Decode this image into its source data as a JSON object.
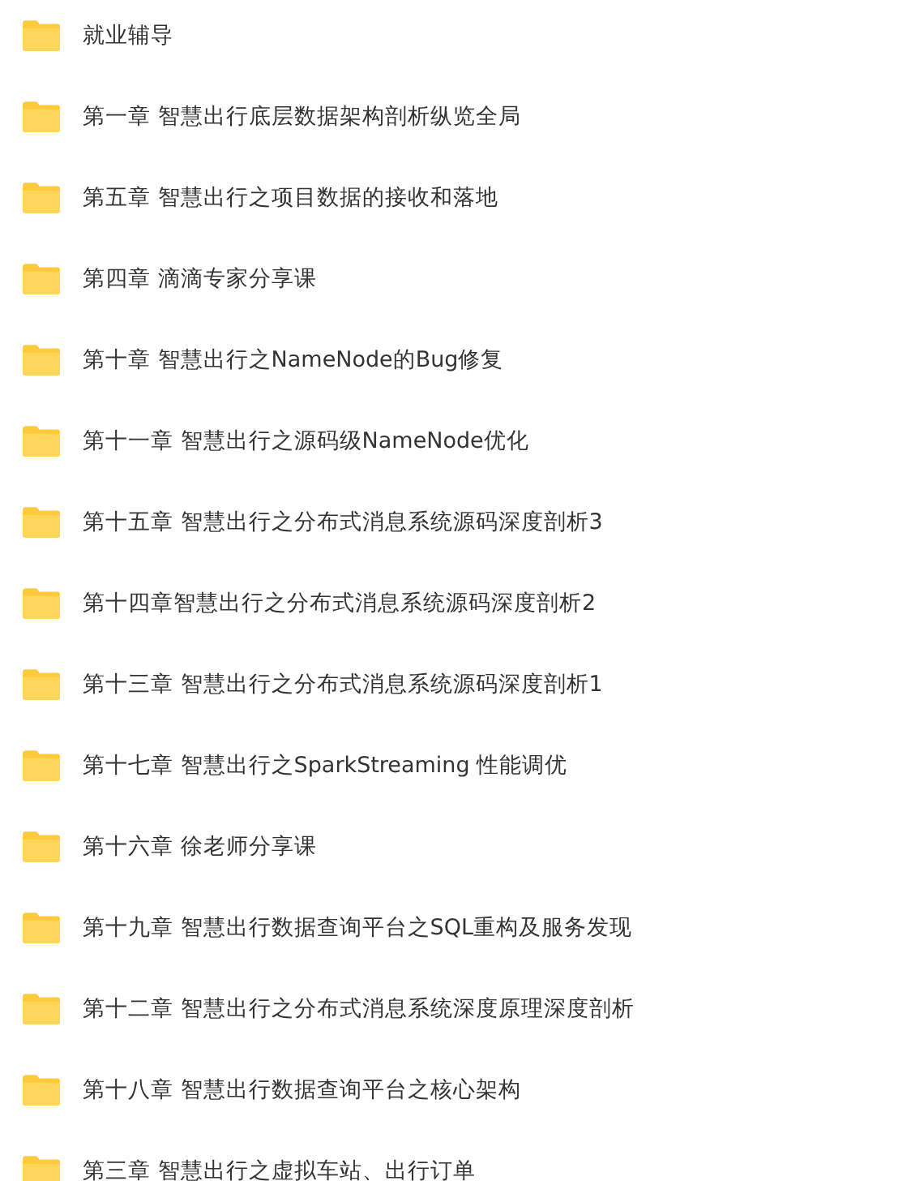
{
  "folders": [
    {
      "name": "就业辅导"
    },
    {
      "name": "第一章 智慧出行底层数据架构剖析纵览全局"
    },
    {
      "name": "第五章 智慧出行之项目数据的接收和落地"
    },
    {
      "name": "第四章 滴滴专家分享课"
    },
    {
      "name": "第十章 智慧出行之NameNode的Bug修复"
    },
    {
      "name": "第十一章 智慧出行之源码级NameNode优化"
    },
    {
      "name": "第十五章 智慧出行之分布式消息系统源码深度剖析3"
    },
    {
      "name": "第十四章智慧出行之分布式消息系统源码深度剖析2"
    },
    {
      "name": "第十三章 智慧出行之分布式消息系统源码深度剖析1"
    },
    {
      "name": "第十七章 智慧出行之SparkStreaming 性能调优"
    },
    {
      "name": "第十六章 徐老师分享课"
    },
    {
      "name": "第十九章 智慧出行数据查询平台之SQL重构及服务发现"
    },
    {
      "name": "第十二章 智慧出行之分布式消息系统深度原理深度剖析"
    },
    {
      "name": "第十八章 智慧出行数据查询平台之核心架构"
    },
    {
      "name": "第三章 智慧出行之虚拟车站、出行订单"
    }
  ]
}
